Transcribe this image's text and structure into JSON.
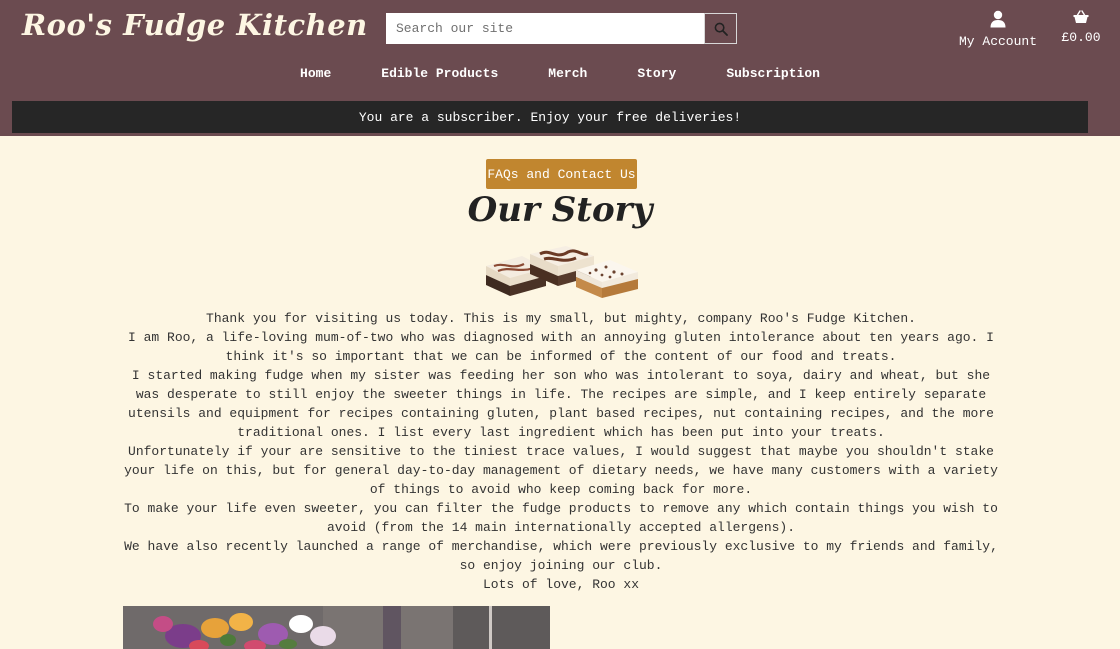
{
  "header": {
    "logo_text": "Roo's Fudge Kitchen",
    "search_placeholder": "Search our site",
    "account_label": "My Account",
    "basket_total": "£0.00",
    "accent_color": "#6b4b50"
  },
  "nav": {
    "items": [
      "Home",
      "Edible Products",
      "Merch",
      "Story",
      "Subscription"
    ]
  },
  "banner": {
    "text": "You are a subscriber. Enjoy your free deliveries!"
  },
  "main": {
    "faq_button": "FAQs and Contact Us",
    "title": "Our Story",
    "paragraphs": [
      "Thank you for visiting us today. This is my small, but mighty, company Roo's Fudge Kitchen.",
      "I am Roo, a life-loving mum-of-two who was diagnosed with an annoying gluten intolerance about ten years ago. I think it's so important that we can be informed of the content of our food and treats.",
      "I started making fudge when my sister was feeding her son who was intolerant to soya, dairy and wheat, but she was desperate to still enjoy the sweeter things in life. The recipes are simple, and I keep entirely separate utensils and equipment for recipes containing gluten, plant based recipes, nut containing recipes, and the more traditional ones. I list every last ingredient which has been put into your treats.",
      "Unfortunately if your are sensitive to the tiniest trace values, I would suggest that maybe you shouldn't stake your life on this, but for general day-to-day management of dietary needs, we have many customers with a variety of things to avoid who keep coming back for more.",
      "To make your life even sweeter, you can filter the fudge products to remove any which contain things you wish to avoid (from the 14 main internationally accepted allergens).",
      "We have also recently launched a range of merchandise, which were previously exclusive to my friends and family, so enjoy joining our club.",
      "Lots of love, Roo xx"
    ],
    "button_color": "#c1862f"
  },
  "icons": {
    "search": "search-icon",
    "account": "user-icon",
    "basket": "basket-icon"
  }
}
